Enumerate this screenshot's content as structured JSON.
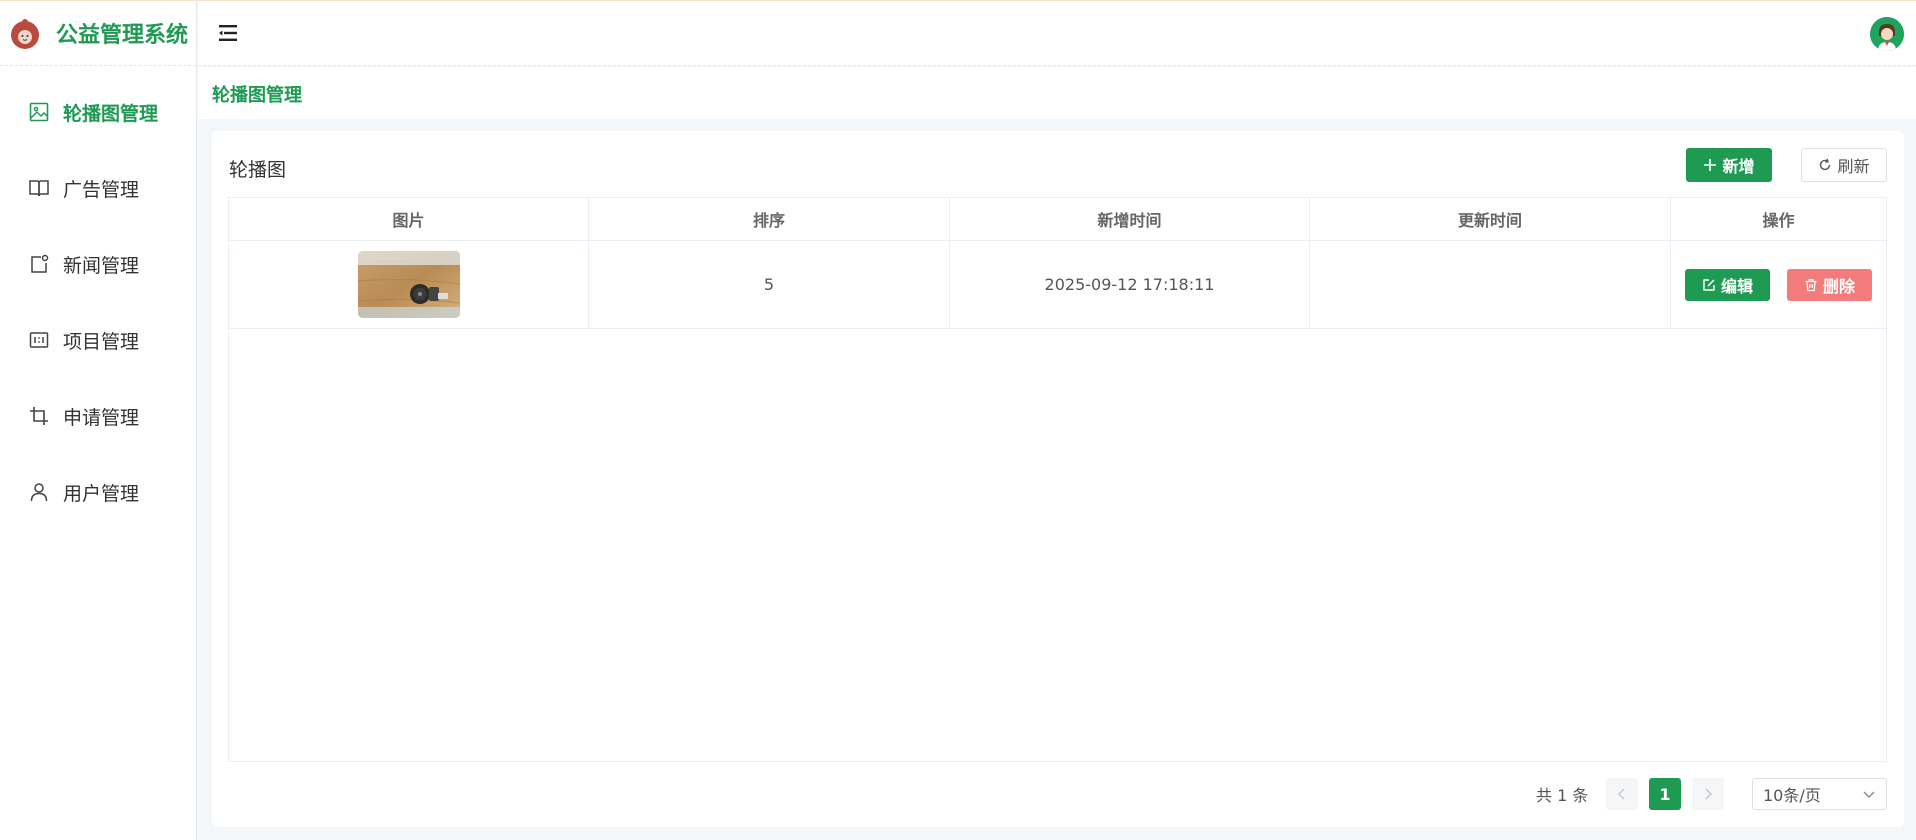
{
  "app": {
    "title": "公益管理系统"
  },
  "sidebar": {
    "items": [
      {
        "label": "轮播图管理",
        "icon": "image-icon",
        "active": true
      },
      {
        "label": "广告管理",
        "icon": "book-icon"
      },
      {
        "label": "新闻管理",
        "icon": "news-icon"
      },
      {
        "label": "项目管理",
        "icon": "ratio-icon"
      },
      {
        "label": "申请管理",
        "icon": "crop-icon"
      },
      {
        "label": "用户管理",
        "icon": "user-icon"
      }
    ]
  },
  "header": {
    "menu_icon": "menu-fold-icon",
    "avatar_icon": "avatar-icon"
  },
  "page": {
    "title": "轮播图管理"
  },
  "card": {
    "title": "轮播图",
    "add_label": "新增",
    "refresh_label": "刷新"
  },
  "table": {
    "columns": [
      "图片",
      "排序",
      "新增时间",
      "更新时间",
      "操作"
    ],
    "rows": [
      {
        "image": "carousel-thumbnail",
        "sort": "5",
        "created": "2025-09-12 17:18:11",
        "updated": "",
        "edit_label": "编辑",
        "delete_label": "删除"
      }
    ]
  },
  "pagination": {
    "total_text": "共 1 条",
    "current_page": "1",
    "page_size": "10条/页"
  },
  "colors": {
    "primary": "#1e9a53",
    "danger": "#f37b7b"
  }
}
